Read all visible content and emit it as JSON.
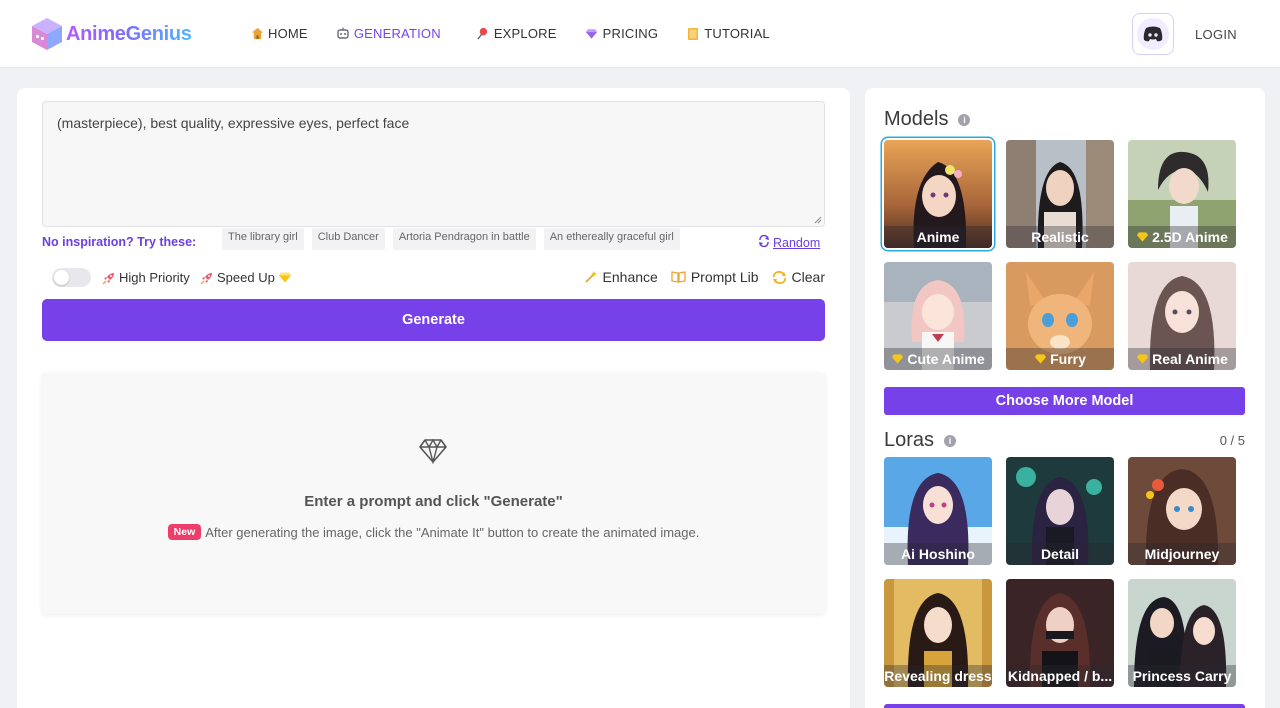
{
  "header": {
    "logo_text": "AnimeGenius",
    "nav": [
      {
        "label": "HOME",
        "icon": "home-icon"
      },
      {
        "label": "GENERATION",
        "icon": "robot-icon",
        "active": true
      },
      {
        "label": "EXPLORE",
        "icon": "pin-icon"
      },
      {
        "label": "PRICING",
        "icon": "gem-icon"
      },
      {
        "label": "TUTORIAL",
        "icon": "book-icon"
      }
    ],
    "login_label": "LOGIN"
  },
  "prompt": {
    "value": "(masterpiece), best quality, expressive eyes, perfect face",
    "inspiration_label": "No inspiration? Try these:",
    "suggestions": [
      "The library girl",
      "Club Dancer",
      "Artoria Pendragon in battle",
      "An ethereally graceful girl"
    ],
    "random_label": "Random"
  },
  "options": {
    "high_priority_label": "High Priority",
    "speed_up_label": "Speed Up",
    "enhance_label": "Enhance",
    "prompt_lib_label": "Prompt Lib",
    "clear_label": "Clear"
  },
  "generate_label": "Generate",
  "result": {
    "title": "Enter a prompt and click \"Generate\"",
    "new_badge": "New",
    "subtitle": "After generating the image, click the \"Animate It\" button to create the animated image."
  },
  "models": {
    "title": "Models",
    "items": [
      {
        "label": "Anime",
        "premium": false,
        "selected": true
      },
      {
        "label": "Realistic",
        "premium": false
      },
      {
        "label": "2.5D Anime",
        "premium": true
      },
      {
        "label": "Cute Anime",
        "premium": true
      },
      {
        "label": "Furry",
        "premium": true
      },
      {
        "label": "Real Anime",
        "premium": true
      }
    ],
    "choose_more_label": "Choose More Model"
  },
  "loras": {
    "title": "Loras",
    "counter": "0 / 5",
    "items": [
      {
        "label": "Ai Hoshino"
      },
      {
        "label": "Detail"
      },
      {
        "label": "Midjourney"
      },
      {
        "label": "Revealing dress"
      },
      {
        "label": "Kidnapped / b..."
      },
      {
        "label": "Princess Carry"
      }
    ]
  },
  "colors": {
    "accent": "#7641e8",
    "link": "#6c3fe0",
    "new_badge": "#ee3d6a",
    "selected_border": "#29a9d8",
    "premium_gem": "#f5c518"
  }
}
